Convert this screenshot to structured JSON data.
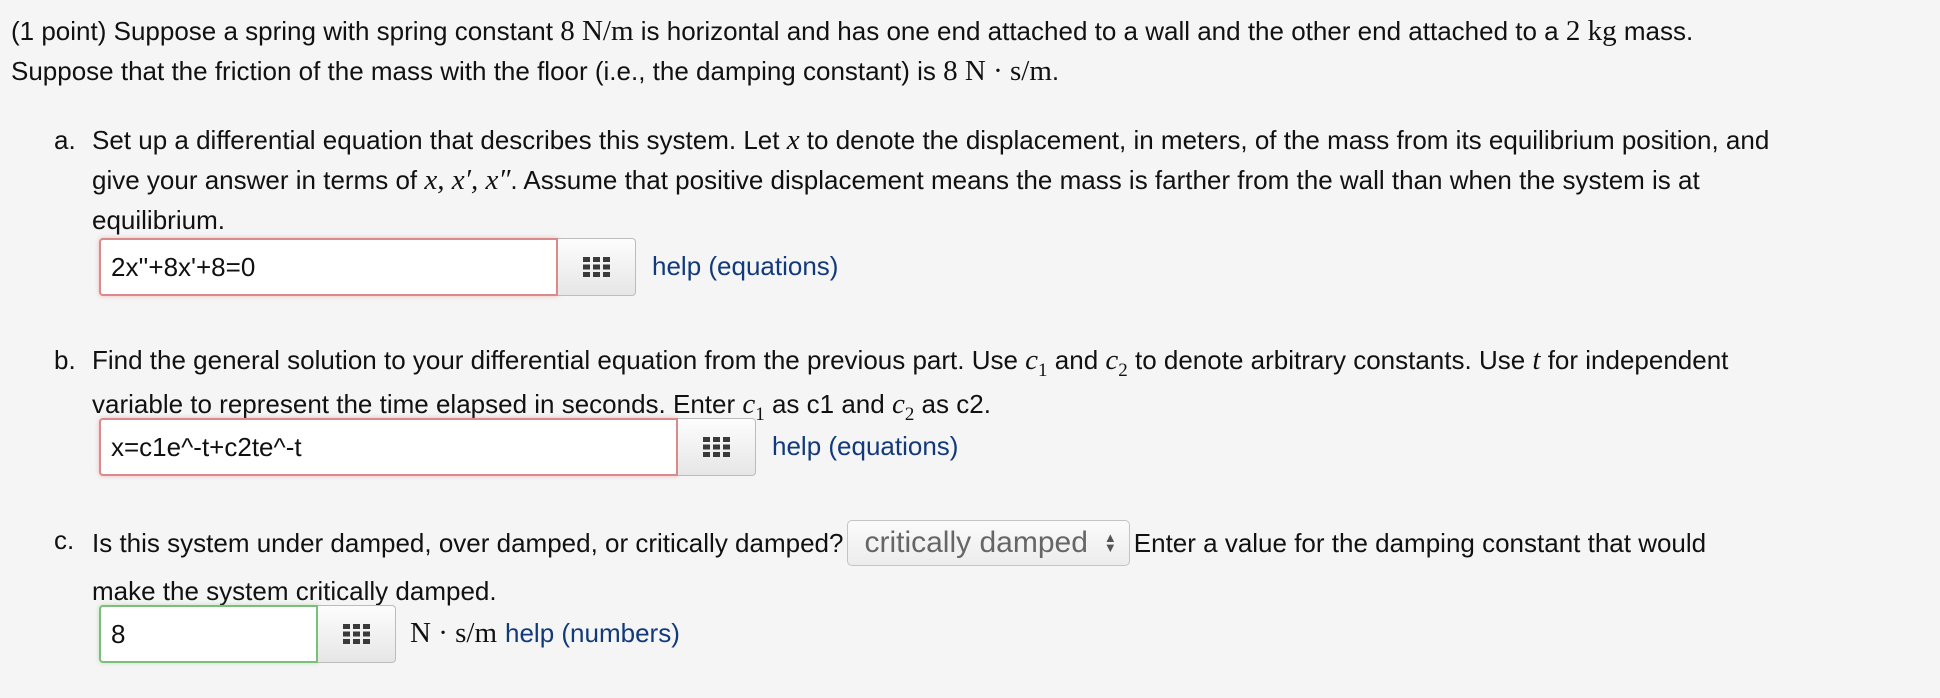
{
  "intro": {
    "t1": "(1 point) Suppose a spring with spring constant ",
    "k": "8 N/m",
    "t2": " is horizontal and has one end attached to a wall and the other end attached to a ",
    "m": "2 kg",
    "t3": " mass.",
    "t4": "Suppose that the friction of the mass with the floor (i.e., the damping constant) is ",
    "c": "8 N · s/m",
    "t5": "."
  },
  "part_a": {
    "letter": "a.",
    "t1": "Set up a differential equation that describes this system. Let ",
    "x": "x",
    "t2": " to denote the displacement, in meters, of the mass from its equilibrium position, and",
    "t3": "give your answer in terms of ",
    "vars": "x, x′, x″",
    "t4": ". Assume that positive displacement means the mass is farther from the wall than when the system is at",
    "t5": "equilibrium.",
    "answer": "2x''+8x'+8=0",
    "help": "help (equations)"
  },
  "part_b": {
    "letter": "b.",
    "t1": "Find the general solution to your differential equation from the previous part. Use ",
    "c1": "c",
    "c1_sub": "1",
    "t2": " and ",
    "c2": "c",
    "c2_sub": "2",
    "t3": " to denote arbitrary constants. Use ",
    "t": "t",
    "t4": " for independent",
    "t5": "variable to represent the time elapsed in seconds. Enter ",
    "t6": " as c1 and ",
    "t7": " as c2.",
    "answer": "x=c1e^-t+c2te^-t",
    "help": "help (equations)"
  },
  "part_c": {
    "letter": "c.",
    "t1": "Is this system under damped, over damped, or critically damped?",
    "select_value": "critically damped",
    "t2": "Enter a value for the damping constant that would",
    "t3": "make the system critically damped.",
    "answer": "8",
    "unit": "N · s/m",
    "help": "help (numbers)"
  }
}
